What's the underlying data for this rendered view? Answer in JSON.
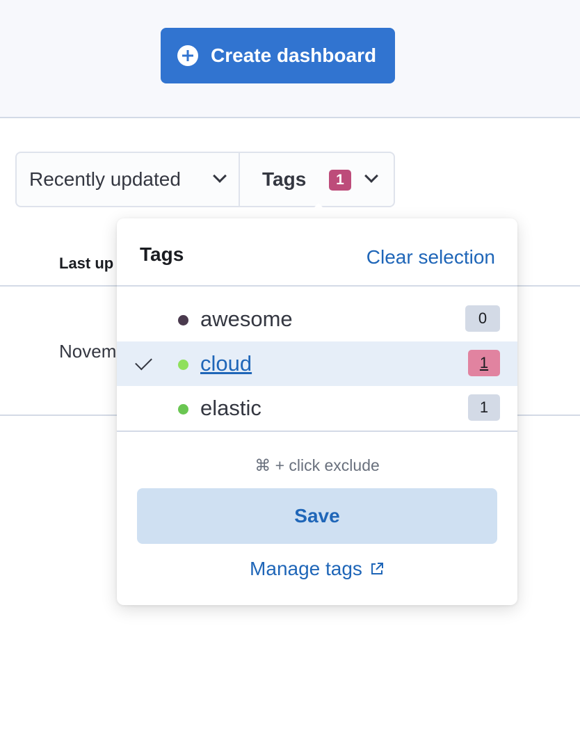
{
  "header": {
    "create_label": "Create dashboard"
  },
  "filters": {
    "sort_label": "Recently updated",
    "tags_label": "Tags",
    "tags_count": "1"
  },
  "table": {
    "column_last_updated": "Last up",
    "row_date": "Novem"
  },
  "tags_popover": {
    "title": "Tags",
    "clear_label": "Clear selection",
    "items": [
      {
        "name": "awesome",
        "count": "0",
        "color": "#4a3a4e",
        "selected": false
      },
      {
        "name": "cloud",
        "count": "1",
        "color": "#8fe05b",
        "selected": true
      },
      {
        "name": "elastic",
        "count": "1",
        "color": "#6ac652",
        "selected": false
      }
    ],
    "hint": "⌘ + click exclude",
    "save_label": "Save",
    "manage_label": "Manage tags"
  },
  "colors": {
    "primary": "#3174d0",
    "tag_badge_selected": "#e183a0",
    "tag_badge_default": "#d3dae6",
    "link": "#1f66b8"
  }
}
